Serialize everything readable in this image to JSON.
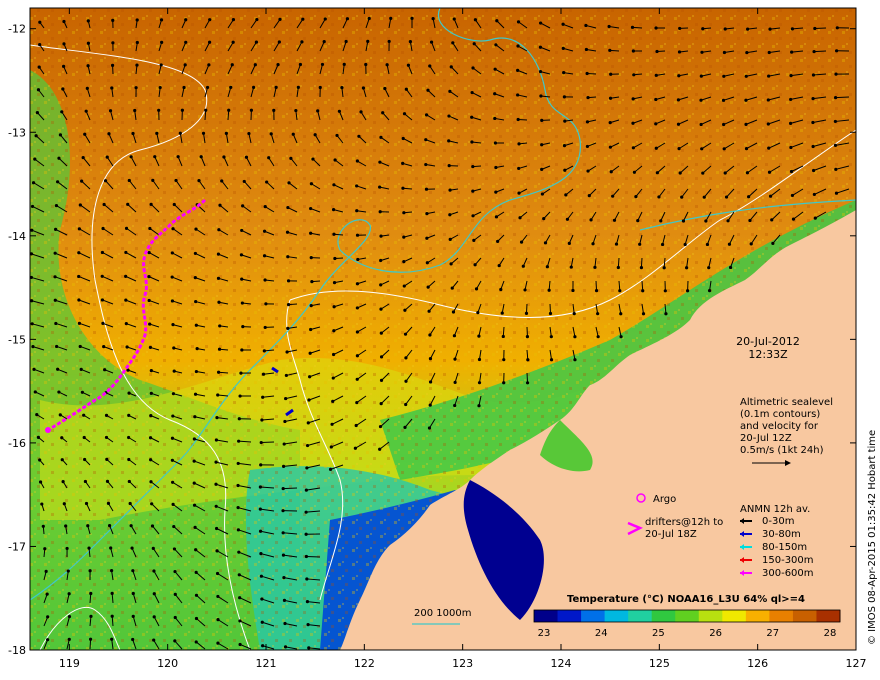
{
  "map": {
    "lon_range": [
      118.6,
      127.0
    ],
    "lat_range": [
      -18.0,
      -11.8
    ],
    "lon_ticks": [
      "119",
      "120",
      "121",
      "122",
      "123",
      "124",
      "125",
      "126",
      "127"
    ],
    "lat_ticks": [
      "-12",
      "-13",
      "-14",
      "-15",
      "-16",
      "-17",
      "-18"
    ]
  },
  "info": {
    "date": "20-Jul-2012",
    "time": "12:33Z",
    "altimetry_lines": [
      "Altimetric sealevel",
      "(0.1m contours)",
      "and velocity for",
      "20-Jul 12Z",
      "0.5m/s (1kt 24h)"
    ],
    "argo_label": "Argo",
    "drifters_line1": "drifters@12h to",
    "drifters_line2": "20-Jul 18Z",
    "anmn_title": "ANMN 12h av.",
    "anmn_items": [
      {
        "label": "0-30m",
        "color": "#000000"
      },
      {
        "label": "30-80m",
        "color": "#0000cc"
      },
      {
        "label": "80-150m",
        "color": "#00dddd"
      },
      {
        "label": "150-300m",
        "color": "#ee0000"
      },
      {
        "label": "300-600m",
        "color": "#ff00ff"
      }
    ]
  },
  "colorbar": {
    "title": "Temperature (°C) NOAA16_L3U 64% ql>=4",
    "ticks": [
      "23",
      "24",
      "25",
      "26",
      "27",
      "28"
    ],
    "colors": [
      "#00008a",
      "#0018c8",
      "#0070e8",
      "#00b8e0",
      "#20d0a0",
      "#30c840",
      "#60d020",
      "#b8e010",
      "#f0e800",
      "#f8b000",
      "#e88000",
      "#c86000",
      "#a83000"
    ]
  },
  "depth_legend": {
    "label": "200  1000m",
    "color": "#40c8c8"
  },
  "credit": "© IMOS 08-Apr-2015 01:35:42 Hobart time",
  "colors": {
    "land": "#f8c8a0",
    "drifter": "#ff00ff",
    "isobath_200": "#40c8c8",
    "sealevel_contour": "#ffffff"
  }
}
